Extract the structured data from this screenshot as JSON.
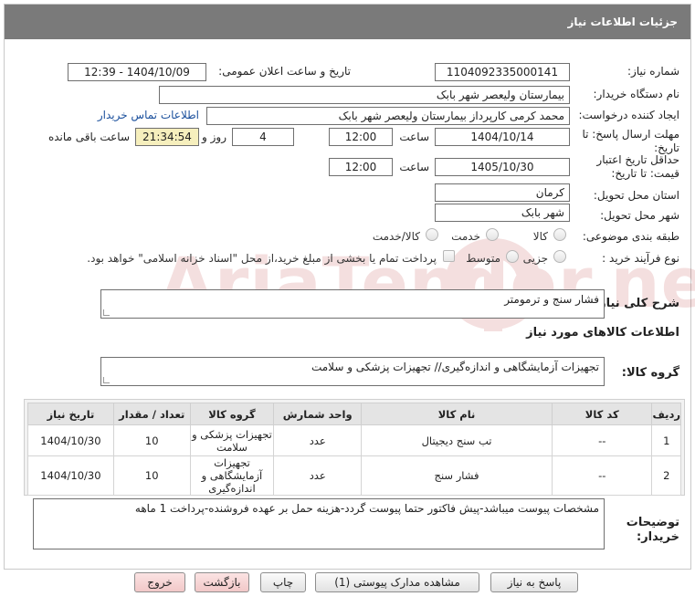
{
  "header": {
    "title": "جزئیات اطلاعات نیاز"
  },
  "form": {
    "need_number": {
      "label": "شماره نیاز:",
      "value": "1104092335000141"
    },
    "announce_datetime": {
      "label": "تاریخ و ساعت اعلان عمومی:",
      "value": "1404/10/09 - 12:39"
    },
    "buyer_org": {
      "label": "نام دستگاه خریدار:",
      "value": "بیمارستان ولیعصر شهر بابک"
    },
    "requester": {
      "label": "ایجاد کننده درخواست:",
      "value": "محمد  کرمی  کارپرداز  بیمارستان ولیعصر شهر بابک",
      "contact_link": "اطلاعات تماس خریدار"
    },
    "reply_deadline": {
      "label_line1": "مهلت ارسال پاسخ: تا",
      "label_line2": "تاریخ:",
      "date": "1404/10/14",
      "time_label": "ساعت",
      "time": "12:00",
      "days": "4",
      "days_label": "روز و",
      "remaining": "21:34:54",
      "remaining_label": "ساعت باقی مانده"
    },
    "price_validity": {
      "label_line1": "حداقل تاریخ اعتبار",
      "label_line2": "قیمت: تا تاریخ:",
      "date": "1405/10/30",
      "time_label": "ساعت",
      "time": "12:00"
    },
    "province": {
      "label": "استان محل تحویل:",
      "value": "کرمان"
    },
    "city": {
      "label": "شهر محل تحویل:",
      "value": "شهر بابک"
    },
    "category": {
      "label": "طبقه بندی موضوعی:",
      "options": [
        "کالا",
        "خدمت",
        "کالا/خدمت"
      ]
    },
    "process_type": {
      "label": "نوع فرآیند خرید :",
      "options": [
        "جزیی",
        "متوسط"
      ],
      "checkbox_text": "پرداخت تمام یا بخشی از مبلغ خرید،از محل \"اسناد خزانه اسلامی\" خواهد بود."
    }
  },
  "need_desc": {
    "label": "شرح کلی نیاز:",
    "value": "فشار سنج و ترمومتر"
  },
  "goods_section": {
    "title": "اطلاعات کالاهای مورد نیاز"
  },
  "goods_group": {
    "label": "گروه کالا:",
    "value": "تجهیزات آزمایشگاهی و اندازه‌گیری// تجهیزات پزشکی و سلامت"
  },
  "table": {
    "headers": [
      "ردیف",
      "کد کالا",
      "نام کالا",
      "واحد شمارش",
      "گروه کالا",
      "تعداد / مقدار",
      "تاریخ نیاز"
    ],
    "rows": [
      {
        "row": "1",
        "code": "--",
        "name": "تب سنج دیجیتال",
        "unit": "عدد",
        "group": "تجهیزات پزشکی و سلامت",
        "qty": "10",
        "date": "1404/10/30"
      },
      {
        "row": "2",
        "code": "--",
        "name": "فشار سنج",
        "unit": "عدد",
        "group": "تجهیزات آزمایشگاهی و اندازه‌گیری",
        "qty": "10",
        "date": "1404/10/30"
      }
    ]
  },
  "buyer_notes": {
    "label_line1": "توضیحات",
    "label_line2": "خریدار:",
    "value": "مشخصات پیوست میباشد-پیش فاکتور حتما پیوست گردد-هزینه حمل بر عهده فروشنده-پرداخت 1 ماهه"
  },
  "buttons": {
    "reply": "پاسخ به نیاز",
    "view_docs": "مشاهده مدارک پیوستی (1)",
    "print": "چاپ",
    "back": "بازگشت",
    "exit": "خروج"
  },
  "watermark": "AriaTender.net",
  "colors": {
    "header_bg": "#7a7a7a",
    "timer_bg": "#f6efbd",
    "link": "#1a4f9c",
    "watermark": "#b01010"
  }
}
